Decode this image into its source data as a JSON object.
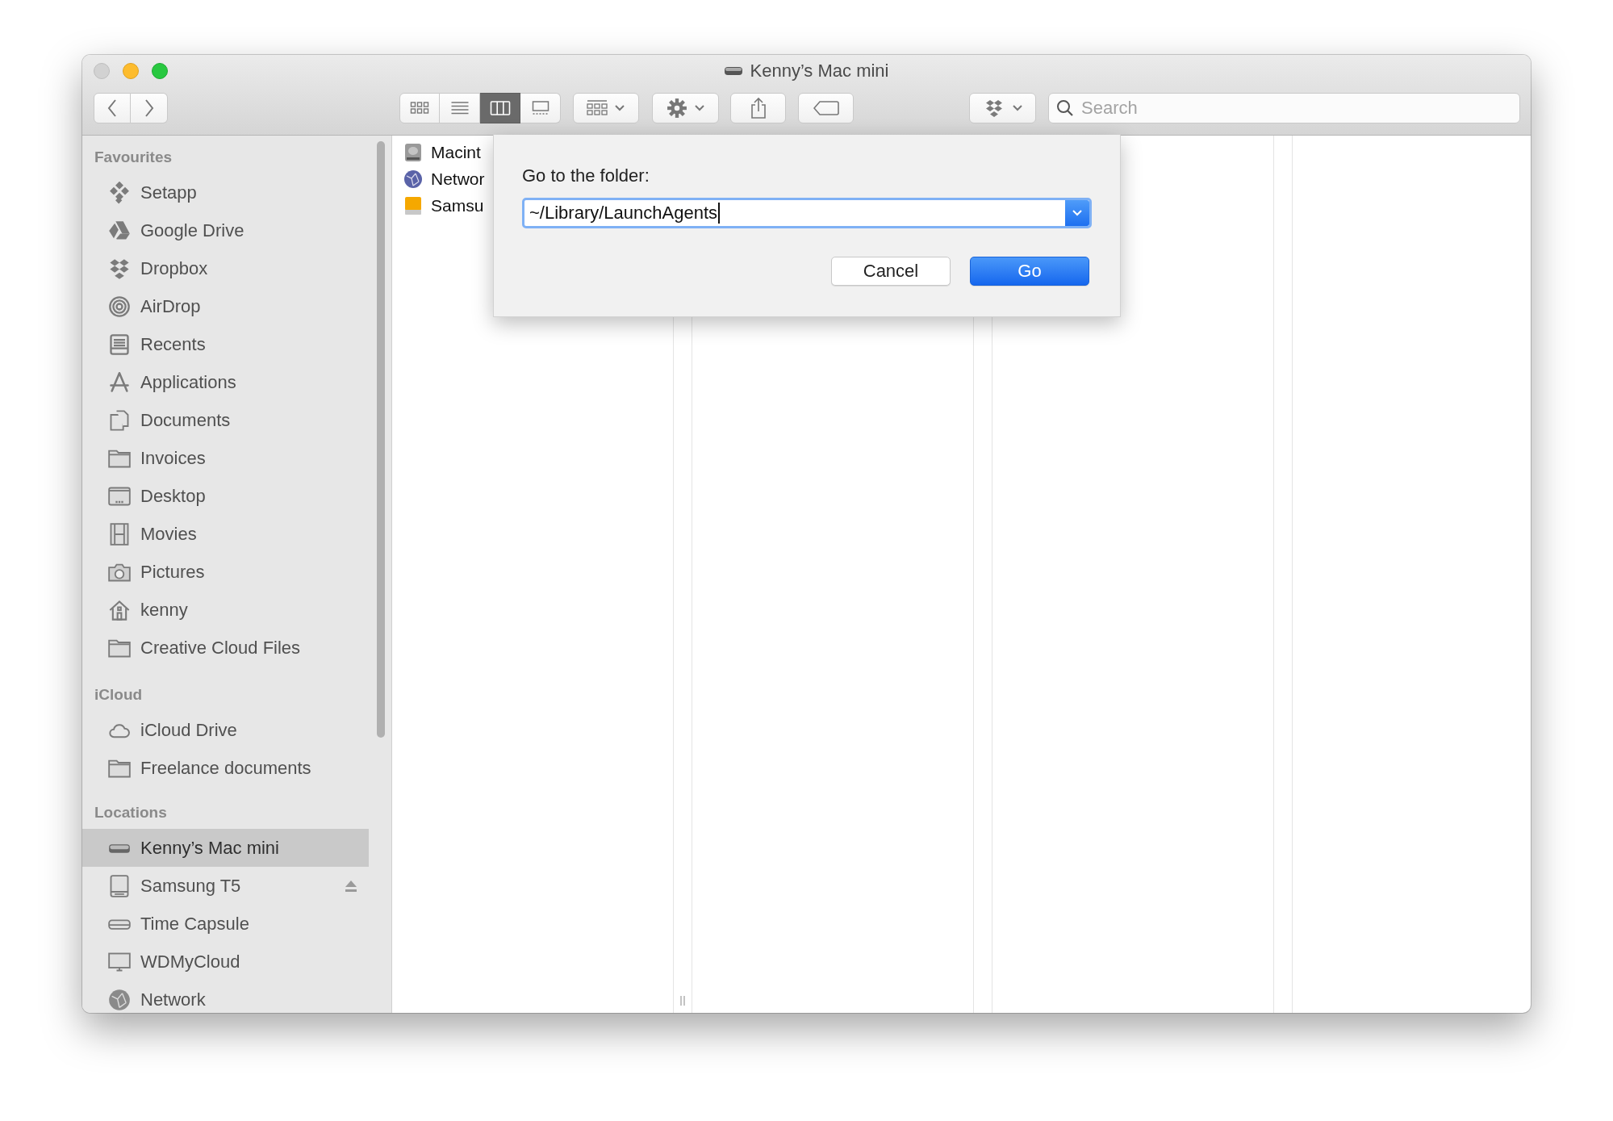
{
  "window": {
    "title": "Kenny’s Mac mini"
  },
  "toolbar": {
    "view_modes": [
      {
        "selected": false
      },
      {
        "selected": false
      },
      {
        "selected": true
      },
      {
        "selected": false
      }
    ],
    "search": {
      "placeholder": "Search"
    }
  },
  "sidebar": {
    "sections": [
      {
        "title": "Favourites",
        "items": [
          {
            "label": "Setapp",
            "selected": false
          },
          {
            "label": "Google Drive",
            "selected": false
          },
          {
            "label": "Dropbox",
            "selected": false
          },
          {
            "label": "AirDrop",
            "selected": false
          },
          {
            "label": "Recents",
            "selected": false
          },
          {
            "label": "Applications",
            "selected": false
          },
          {
            "label": "Documents",
            "selected": false
          },
          {
            "label": "Invoices",
            "selected": false
          },
          {
            "label": "Desktop",
            "selected": false
          },
          {
            "label": "Movies",
            "selected": false
          },
          {
            "label": "Pictures",
            "selected": false
          },
          {
            "label": "kenny",
            "selected": false
          },
          {
            "label": "Creative Cloud Files",
            "selected": false
          }
        ]
      },
      {
        "title": "iCloud",
        "items": [
          {
            "label": "iCloud Drive",
            "selected": false
          },
          {
            "label": "Freelance documents",
            "selected": false
          }
        ]
      },
      {
        "title": "Locations",
        "items": [
          {
            "label": "Kenny’s Mac mini",
            "selected": true,
            "ejectable": false
          },
          {
            "label": "Samsung T5",
            "selected": false,
            "ejectable": true
          },
          {
            "label": "Time Capsule",
            "selected": false,
            "ejectable": false
          },
          {
            "label": "WDMyCloud",
            "selected": false,
            "ejectable": false
          },
          {
            "label": "Network",
            "selected": false,
            "ejectable": false
          }
        ]
      }
    ]
  },
  "columns": [
    {
      "items": [
        {
          "name": "Macint"
        },
        {
          "name": "Networ"
        },
        {
          "name": "Samsu"
        }
      ]
    }
  ],
  "dialog": {
    "label": "Go to the folder:",
    "value": "~/Library/LaunchAgents",
    "buttons": [
      {
        "label": "Cancel",
        "default": false
      },
      {
        "label": "Go",
        "default": true
      }
    ]
  }
}
